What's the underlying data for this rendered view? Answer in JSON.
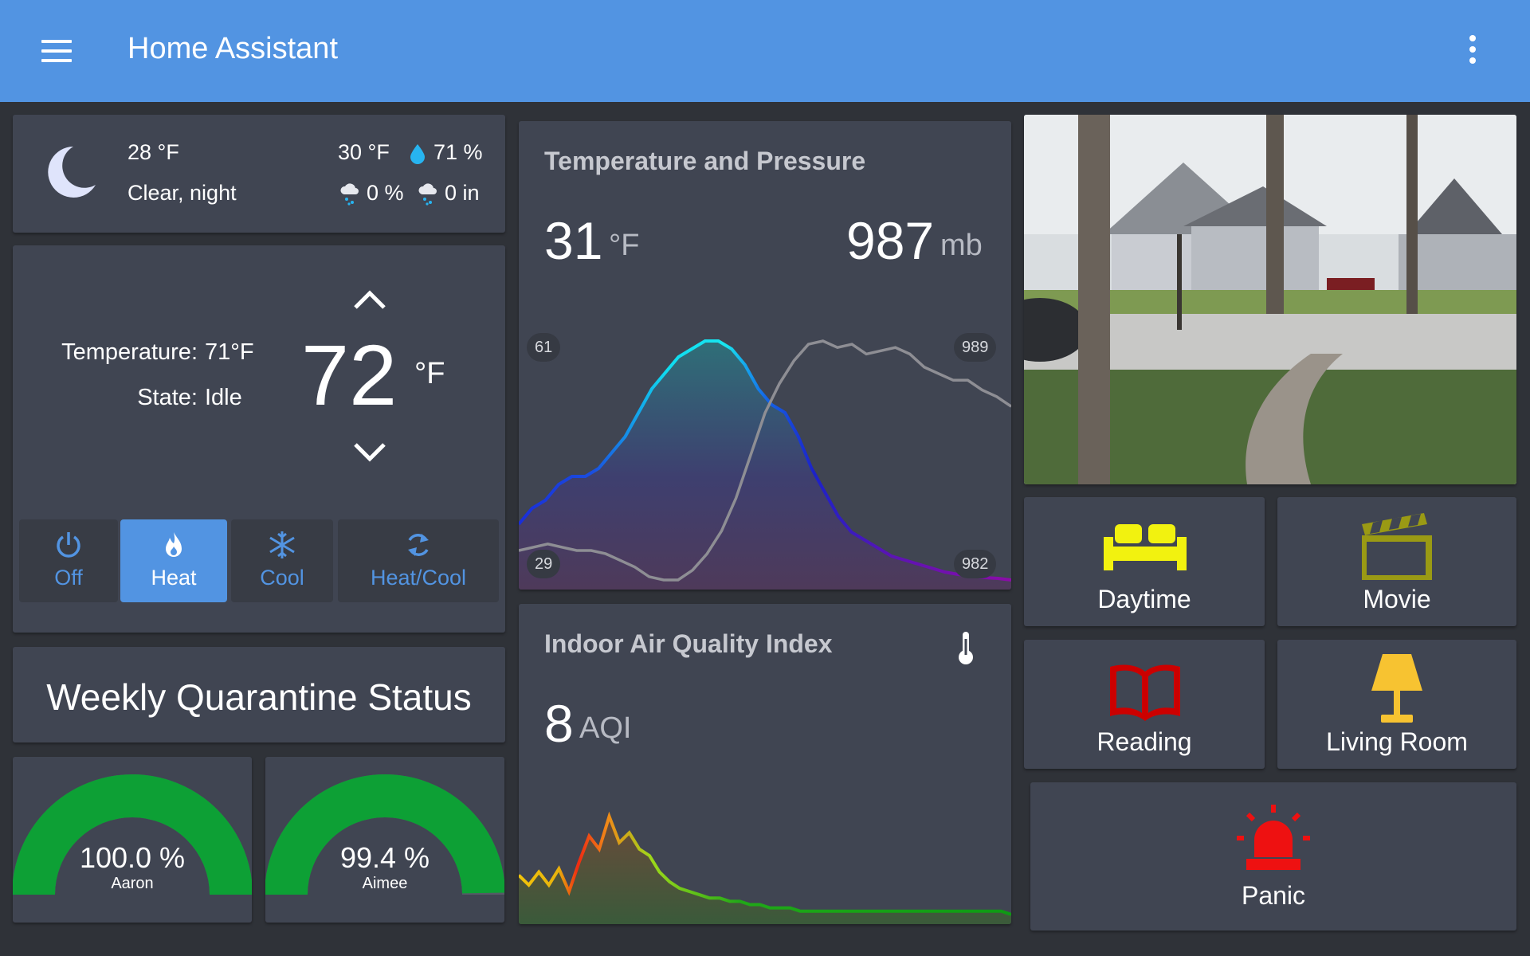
{
  "header": {
    "title": "Home Assistant",
    "menu_icon": "menu-icon",
    "more_icon": "kebab-icon"
  },
  "weather": {
    "icon": "moon-icon",
    "temperature": "28 °F",
    "condition": "Clear, night",
    "high": "30 °F",
    "humidity": "71 %",
    "precip_probability": "0 %",
    "precip_amount": "0 in"
  },
  "thermostat": {
    "temperature_label": "Temperature:",
    "temperature_value": "71°F",
    "state_label": "State:",
    "state_value": "Idle",
    "setpoint": "72",
    "setpoint_unit": "°F",
    "modes": [
      {
        "label": "Off",
        "icon": "power-icon",
        "active": false
      },
      {
        "label": "Heat",
        "icon": "fire-icon",
        "active": true
      },
      {
        "label": "Cool",
        "icon": "snowflake-icon",
        "active": false
      },
      {
        "label": "Heat/Cool",
        "icon": "autorenew-icon",
        "active": false
      }
    ]
  },
  "quarantine": {
    "title": "Weekly Quarantine Status",
    "gauges": [
      {
        "name": "Aaron",
        "value_label": "100.0 %",
        "value": 100.0
      },
      {
        "name": "Aimee",
        "value_label": "99.4 %",
        "value": 99.4
      }
    ],
    "gauge_color": "#0da035"
  },
  "temp_pressure": {
    "title": "Temperature and Pressure",
    "temperature": "31",
    "temperature_unit": "°F",
    "pressure": "987",
    "pressure_unit": "mb",
    "temp_max_label": "61",
    "temp_min_label": "29",
    "pressure_max_label": "989",
    "pressure_min_label": "982"
  },
  "air_quality": {
    "title": "Indoor Air Quality Index",
    "icon": "thermometer-icon",
    "value": "8",
    "unit": "AQI"
  },
  "scenes": [
    {
      "label": "Daytime",
      "icon": "sofa-icon",
      "color": "#f2f20f"
    },
    {
      "label": "Movie",
      "icon": "clapperboard-icon",
      "color": "#9a9a14"
    },
    {
      "label": "Reading",
      "icon": "book-icon",
      "color": "#cc0000"
    },
    {
      "label": "Living Room",
      "icon": "lamp-icon",
      "color": "#f7c331"
    },
    {
      "label": "Panic",
      "icon": "alarm-light-icon",
      "color": "#ee1111"
    }
  ],
  "chart_data": [
    {
      "type": "area",
      "series": [
        {
          "values": [
            38,
            40,
            41,
            43,
            44,
            44,
            45,
            47,
            49,
            52,
            55,
            57,
            59,
            60,
            61,
            61,
            60,
            58,
            55,
            53,
            52,
            49,
            45,
            42,
            39,
            37,
            36,
            35,
            34,
            33.5,
            33,
            32.5,
            32,
            31.7,
            31.5,
            31.3,
            31.2,
            31
          ]
        },
        {
          "values": [
            982.6,
            982.7,
            982.8,
            982.7,
            982.6,
            982.6,
            982.5,
            982.3,
            982.1,
            981.8,
            981.7,
            981.7,
            982,
            982.5,
            983.2,
            984.2,
            985.5,
            986.8,
            987.7,
            988.4,
            988.9,
            989,
            988.8,
            988.9,
            988.6,
            988.7,
            988.8,
            988.6,
            988.2,
            988,
            987.8,
            987.8,
            987.5,
            987.3,
            987
          ]
        }
      ]
    },
    {
      "type": "area",
      "series": [
        {
          "values": [
            14,
            11,
            15,
            11,
            16,
            9,
            18,
            26,
            22,
            32,
            24,
            27,
            22,
            20,
            15,
            12,
            10,
            9,
            8,
            7,
            7,
            6,
            6,
            5,
            5,
            4,
            4,
            4,
            3,
            3,
            3,
            3,
            3,
            3,
            3,
            3,
            3,
            3,
            3,
            3,
            3,
            3,
            3,
            3,
            3,
            3,
            3,
            3,
            3,
            2
          ]
        }
      ],
      "ylim": [
        0,
        40
      ]
    }
  ]
}
